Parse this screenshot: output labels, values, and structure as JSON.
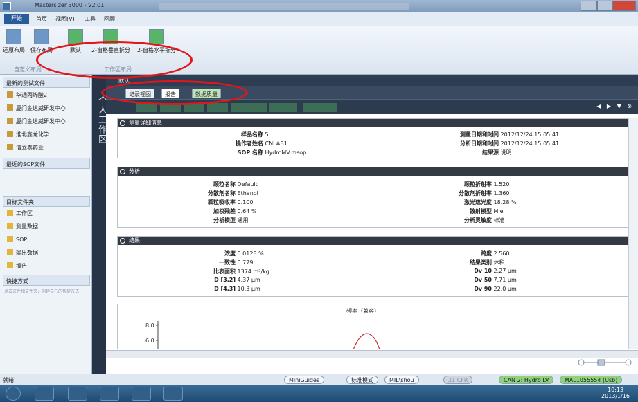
{
  "window": {
    "title": "Mastersizer 3000 - V2.01"
  },
  "menubar": {
    "app_button": "开始",
    "items": [
      "首页",
      "视图(V)",
      "工具",
      "回顾"
    ]
  },
  "ribbon": {
    "buttons": [
      "还原布局",
      "保存布局",
      "默认",
      "2-窗格垂直拆分",
      "2-窗格水平拆分"
    ],
    "groups": [
      "自定义布局",
      "工作区布局"
    ]
  },
  "left_pane": {
    "recent_header": "最新的测试文件",
    "recent_files": [
      "华通丙烯酸2",
      "厦门金达威研发中心",
      "厦门金达威研发中心",
      "淮北鑫龙化学",
      "信立泰药业"
    ],
    "sop_header": "最近的SOP文件",
    "folders_header": "目标文件夹",
    "folders": [
      "工作区",
      "测量数据",
      "SOP",
      "输出数据",
      "报告"
    ],
    "shortcuts_header": "快捷方式",
    "shortcuts_hint": "点击文件和文件夹，创建自己的快捷方式"
  },
  "vertical_tab": {
    "label": "个人工作区"
  },
  "content": {
    "view_name": "默认",
    "tabs": [
      "记录视图",
      "报告",
      "数据质量"
    ],
    "nav": "◀ ▶ ▼ ⊗"
  },
  "measurement": {
    "header": "测量详细信息",
    "sample_name_label": "样品名称",
    "sample_name": "5",
    "operator_label": "操作者姓名",
    "operator": "CNLAB1",
    "sop_label": "SOP 名称",
    "sop": "HydroMV.msop",
    "measured_label": "测量日期和时间",
    "measured": "2012/12/24 15:05:41",
    "analysed_label": "分析日期和时间",
    "analysed": "2012/12/24 15:05:41",
    "source_label": "结果源",
    "source": "说明"
  },
  "analysis": {
    "header": "分析",
    "particle_name_label": "颗粒名称",
    "particle_name": "Default",
    "dispersant_label": "分散剂名称",
    "dispersant": "Ethanol",
    "absorption_label": "颗粒吸收率",
    "absorption": "0.100",
    "residual_label": "加权残差",
    "residual": "0.64 %",
    "model_label": "分析模型",
    "model": "通用",
    "ri_label": "颗粒折射率",
    "ri": "1.520",
    "disp_ri_label": "分散剂折射率",
    "disp_ri": "1.360",
    "obscuration_label": "激光遮光度",
    "obscuration": "18.28 %",
    "scatter_label": "散射模型",
    "scatter": "Mie",
    "sensitivity_label": "分析灵敏度",
    "sensitivity": "标准"
  },
  "results": {
    "header": "结果",
    "concentration_label": "浓度",
    "concentration": "0.0128 %",
    "uniformity_label": "一致性",
    "uniformity": "0.779",
    "ssa_label": "比表面积",
    "ssa": "1374 m²/kg",
    "d32_label": "D [3,2]",
    "d32": "4.37 μm",
    "d43_label": "D [4,3]",
    "d43": "10.3 μm",
    "span_label": "跨度",
    "span": "2.560",
    "type_label": "结果类别",
    "type": "体积",
    "dv10_label": "Dv 10",
    "dv10": "2.27 μm",
    "dv50_label": "Dv 50",
    "dv50": "7.71 μm",
    "dv90_label": "Dv 90",
    "dv90": "22.0 μm"
  },
  "chart_data": {
    "type": "line",
    "title": "频率（兼容）",
    "yticks": [
      "8.0",
      "6.0"
    ]
  },
  "statusbar": {
    "left": "就绪",
    "buttons": [
      "MiniGuides",
      "标准模式",
      "MIL\\shou",
      "21 CFR",
      "CAN 2: Hydro LV",
      "MAL1055554 (Usb)"
    ]
  },
  "taskbar": {
    "time": "10:13",
    "date": "2013/1/16"
  },
  "colors": {
    "annotation": "#e3161b",
    "accent": "#2b5c9a"
  }
}
